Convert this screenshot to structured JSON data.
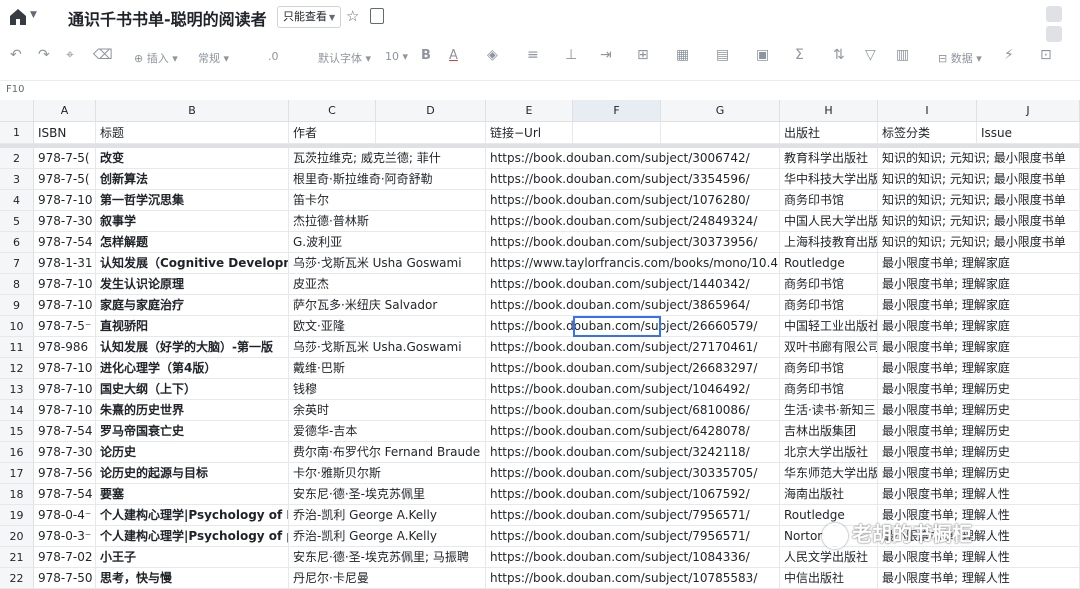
{
  "app": {
    "title": "通识千书书单-聪明的阅读者",
    "mode_label": "只能查看",
    "home_icon": "home-icon",
    "star_icon": "star-icon"
  },
  "toolbar": {
    "undo": "↶",
    "redo": "↷",
    "format_painter": "⌖",
    "clear": "⌫",
    "insert_label": "插入",
    "number_format": "常规",
    "decimal": ".0",
    "font": "默认字体",
    "font_size": "10",
    "bold": "B",
    "text_color": "A",
    "sum": "Σ",
    "filter": "▽",
    "data_label": "数据"
  },
  "formula_bar": {
    "cell_ref": "F10"
  },
  "columns": [
    "A",
    "B",
    "C",
    "D",
    "E",
    "F",
    "G",
    "H",
    "I",
    "J"
  ],
  "selected_column": "F",
  "selected_cell": "F10",
  "header_row": [
    "ISBN",
    "标题",
    "作者",
    "",
    "链接−Url",
    "",
    "",
    "出版社",
    "标签分类",
    "Issue"
  ],
  "rows": [
    {
      "n": "2",
      "isbn": "978-7-5(",
      "title": "改变",
      "author": "瓦茨拉维克; 威克兰德; 菲什",
      "url": "https://book.douban.com/subject/3006742/",
      "pub": "教育科学出版社",
      "tags": "知识的知识; 元知识; 最小限度书单"
    },
    {
      "n": "3",
      "isbn": "978-7-5(",
      "title": "创新算法",
      "author": "根里奇·斯拉维奇·阿奇舒勒",
      "url": "https://book.douban.com/subject/3354596/",
      "pub": "华中科技大学出版",
      "tags": "知识的知识; 元知识; 最小限度书单"
    },
    {
      "n": "4",
      "isbn": "978-7-10",
      "title": "第一哲学沉思集",
      "author": "笛卡尔",
      "url": "https://book.douban.com/subject/1076280/",
      "pub": "商务印书馆",
      "tags": "知识的知识; 元知识; 最小限度书单"
    },
    {
      "n": "5",
      "isbn": "978-7-30",
      "title": "叙事学",
      "author": "杰拉德·普林斯",
      "url": "https://book.douban.com/subject/24849324/",
      "pub": "中国人民大学出版",
      "tags": "知识的知识; 元知识; 最小限度书单"
    },
    {
      "n": "6",
      "isbn": "978-7-54",
      "title": "怎样解题",
      "author": "G.波利亚",
      "url": "https://book.douban.com/subject/30373956/",
      "pub": "上海科技教育出版",
      "tags": "知识的知识; 元知识; 最小限度书单"
    },
    {
      "n": "7",
      "isbn": "978-1-31",
      "title": "认知发展（Cognitive Developme",
      "author": "乌莎·戈斯瓦米 Usha Goswami",
      "url": "https://www.taylorfrancis.com/books/mono/10.4",
      "pub": "Routledge",
      "tags": "最小限度书单; 理解家庭"
    },
    {
      "n": "8",
      "isbn": "978-7-10",
      "title": "发生认识论原理",
      "author": "皮亚杰",
      "url": "https://book.douban.com/subject/1440342/",
      "pub": "商务印书馆",
      "tags": "最小限度书单; 理解家庭"
    },
    {
      "n": "9",
      "isbn": "978-7-10",
      "title": "家庭与家庭治疗",
      "author": "萨尔瓦多·米纽庆 Salvador",
      "url": "https://book.douban.com/subject/3865964/",
      "pub": "商务印书馆",
      "tags": "最小限度书单; 理解家庭"
    },
    {
      "n": "10",
      "isbn": "978-7-5⁻",
      "title": "直视骄阳",
      "author": "欧文·亚隆",
      "url": "https://book.douban.com/subject/26660579/",
      "pub": "中国轻工业出版社",
      "tags": "最小限度书单; 理解家庭"
    },
    {
      "n": "11",
      "isbn": "978-986",
      "title": "认知发展（好学的大脑）-第一版",
      "author": "乌莎·戈斯瓦米 Usha.Goswami",
      "url": "https://book.douban.com/subject/27170461/",
      "pub": "双叶书廊有限公司",
      "tags": "最小限度书单; 理解家庭"
    },
    {
      "n": "12",
      "isbn": "978-7-10",
      "title": "进化心理学（第4版）",
      "author": "戴维·巴斯",
      "url": "https://book.douban.com/subject/26683297/",
      "pub": "商务印书馆",
      "tags": "最小限度书单; 理解家庭"
    },
    {
      "n": "13",
      "isbn": "978-7-10",
      "title": "国史大纲（上下）",
      "author": "钱穆",
      "url": "https://book.douban.com/subject/1046492/",
      "pub": "商务印书馆",
      "tags": "最小限度书单; 理解历史"
    },
    {
      "n": "14",
      "isbn": "978-7-10",
      "title": "朱熹的历史世界",
      "author": "余英时",
      "url": "https://book.douban.com/subject/6810086/",
      "pub": "生活·读书·新知三",
      "tags": "最小限度书单; 理解历史"
    },
    {
      "n": "15",
      "isbn": "978-7-54",
      "title": "罗马帝国衰亡史",
      "author": "爱德华-吉本",
      "url": "https://book.douban.com/subject/6428078/",
      "pub": "吉林出版集团",
      "tags": "最小限度书单; 理解历史"
    },
    {
      "n": "16",
      "isbn": "978-7-30",
      "title": "论历史",
      "author": "费尔南·布罗代尔 Fernand Braude",
      "url": "https://book.douban.com/subject/3242118/",
      "pub": "北京大学出版社",
      "tags": "最小限度书单; 理解历史"
    },
    {
      "n": "17",
      "isbn": "978-7-56",
      "title": "论历史的起源与目标",
      "author": "卡尔·雅斯贝尔斯",
      "url": "https://book.douban.com/subject/30335705/",
      "pub": "华东师范大学出版",
      "tags": "最小限度书单; 理解历史"
    },
    {
      "n": "18",
      "isbn": "978-7-54",
      "title": "要塞",
      "author": "安东尼·德·圣-埃克苏佩里",
      "url": "https://book.douban.com/subject/1067592/",
      "pub": "海南出版社",
      "tags": "最小限度书单; 理解人性"
    },
    {
      "n": "19",
      "isbn": "978-0-4⁻",
      "title": "个人建构心理学|Psychology of P",
      "author": "乔治-凯利 George A.Kelly",
      "url": "https://book.douban.com/subject/7956571/",
      "pub": "Routledge",
      "tags": "最小限度书单; 理解人性"
    },
    {
      "n": "20",
      "isbn": "978-0-3⁻",
      "title": "个人建构心理学|Psychology of p",
      "author": "乔治-凯利 George A.Kelly",
      "url": "https://book.douban.com/subject/7956571/",
      "pub": "Norton",
      "tags": "最小限度书单; 理解人性"
    },
    {
      "n": "21",
      "isbn": "978-7-02",
      "title": "小王子",
      "author": "安东尼·德·圣-埃克苏佩里; 马振聘",
      "url": "https://book.douban.com/subject/1084336/",
      "pub": "人民文学出版社",
      "tags": "最小限度书单; 理解人性"
    },
    {
      "n": "22",
      "isbn": "978-7-50",
      "title": "思考，快与慢",
      "author": "丹尼尔·卡尼曼",
      "url": "https://book.douban.com/subject/10785583/",
      "pub": "中信出版社",
      "tags": "最小限度书单; 理解人性"
    }
  ],
  "watermark": "老胡的书橱柜"
}
